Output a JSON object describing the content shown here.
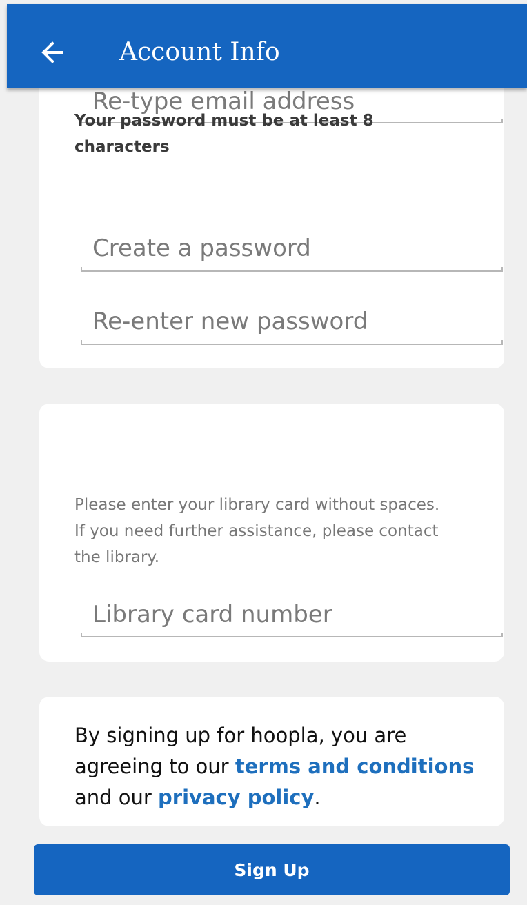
{
  "app_bar": {
    "title": "Account Info",
    "back_icon": "arrow-left-icon",
    "color": "#1565c0"
  },
  "account_card": {
    "retype_email_placeholder": "Re-type email address",
    "password_hint": "Your password must be at least 8 characters",
    "create_password_placeholder": "Create a password",
    "reenter_password_placeholder": "Re-enter new password"
  },
  "library_card": {
    "hint": "Please enter your library card without spaces. If you need further assistance, please contact the library.",
    "card_number_placeholder": "Library card number"
  },
  "terms_card": {
    "text_before": "By signing up for hoopla, you are agreeing to our ",
    "terms_link": "terms and conditions",
    "text_middle": " and our ",
    "privacy_link": "privacy policy",
    "text_after": ".",
    "link_color": "#1e6fbd"
  },
  "signup_button": {
    "label": "Sign Up",
    "color": "#1565c0"
  }
}
